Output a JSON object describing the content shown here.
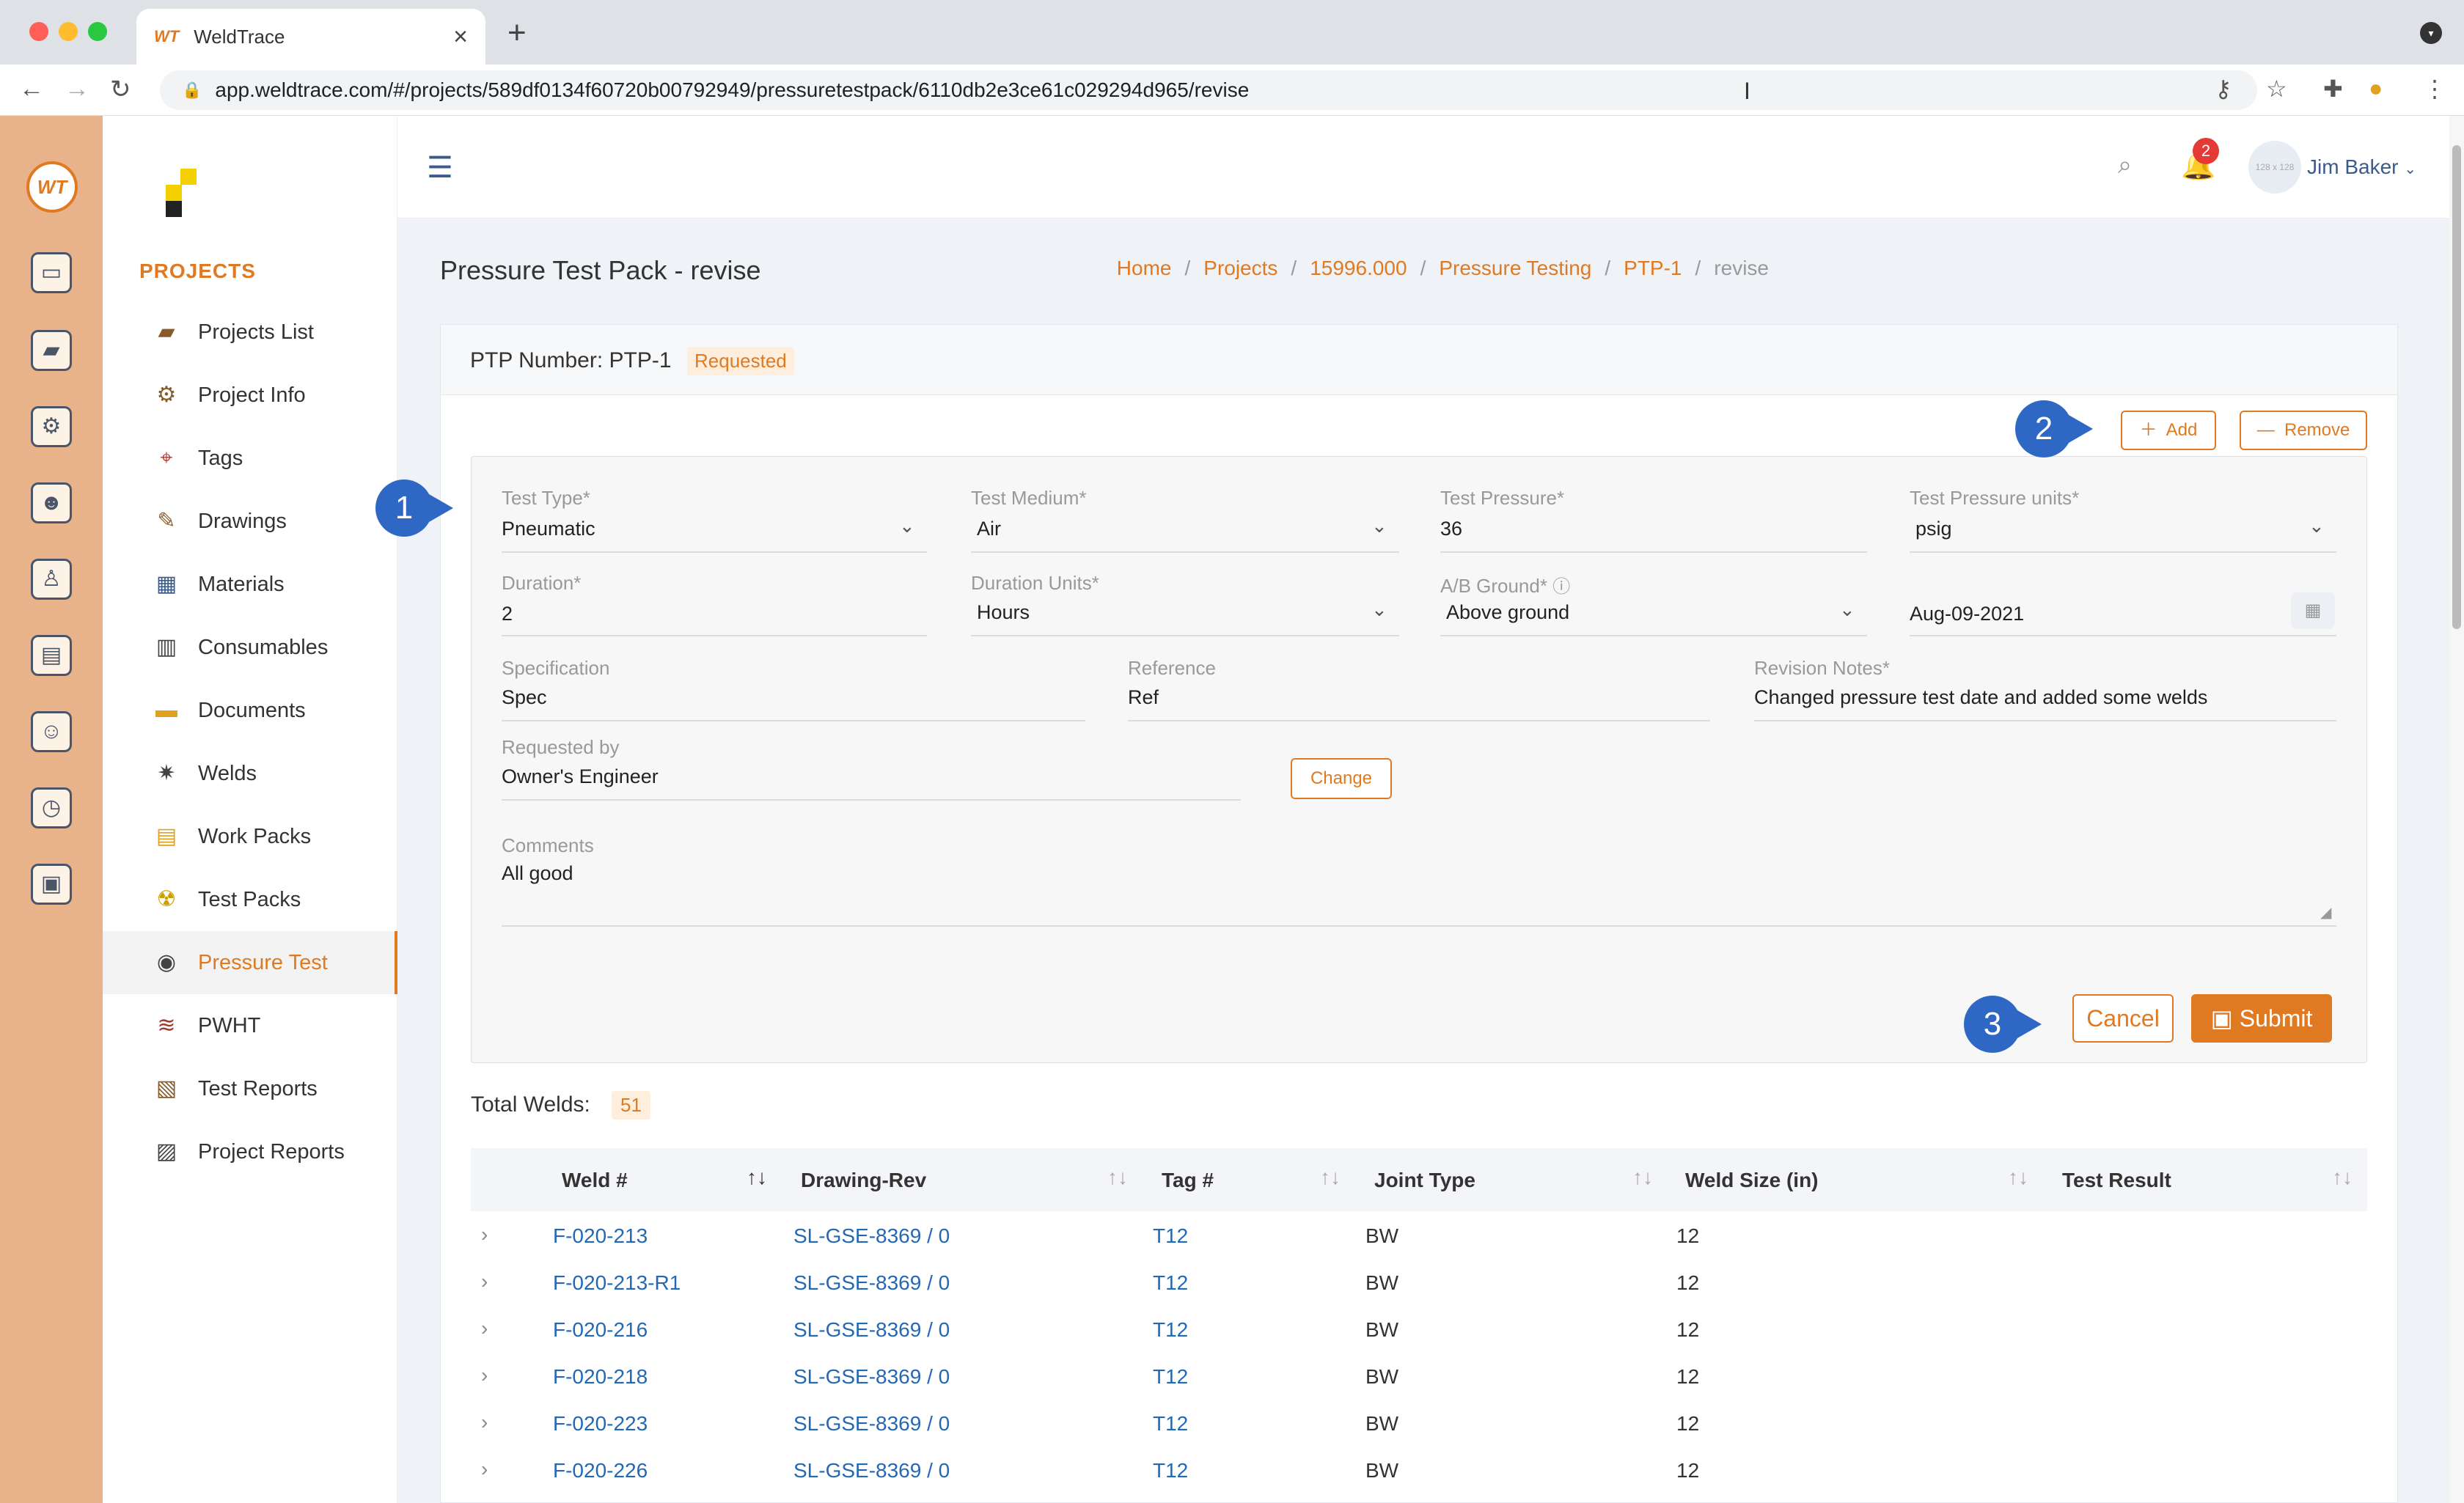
{
  "browser": {
    "tab_icon": "WT",
    "tab_title": "WeldTrace",
    "url": "app.weldtrace.com/#/projects/589df0134f60720b00792949/pressuretestpack/6110db2e3ce61c029294d965/revise"
  },
  "sidebar": {
    "section_title": "PROJECTS",
    "items": [
      {
        "label": "Projects List",
        "icon": "folder-camera-icon"
      },
      {
        "label": "Project Info",
        "icon": "gears-icon"
      },
      {
        "label": "Tags",
        "icon": "tag-icon"
      },
      {
        "label": "Drawings",
        "icon": "drawing-tools-icon"
      },
      {
        "label": "Materials",
        "icon": "materials-icon"
      },
      {
        "label": "Consumables",
        "icon": "consumables-icon"
      },
      {
        "label": "Documents",
        "icon": "documents-icon"
      },
      {
        "label": "Welds",
        "icon": "weld-spark-icon"
      },
      {
        "label": "Work Packs",
        "icon": "work-pack-icon"
      },
      {
        "label": "Test Packs",
        "icon": "radiation-icon"
      },
      {
        "label": "Pressure Test",
        "icon": "pressure-gauge-icon"
      },
      {
        "label": "PWHT",
        "icon": "heater-icon"
      },
      {
        "label": "Test Reports",
        "icon": "clipboard-icon"
      },
      {
        "label": "Project Reports",
        "icon": "report-chart-icon"
      }
    ],
    "active": "Pressure Test"
  },
  "header": {
    "notification_count": "2",
    "avatar_text": "128 x 128",
    "user_name": "Jim Baker"
  },
  "page": {
    "title": "Pressure Test Pack - revise",
    "breadcrumb": [
      "Home",
      "Projects",
      "15996.000",
      "Pressure Testing",
      "PTP-1",
      "revise"
    ]
  },
  "card": {
    "ptp_label": "PTP Number: PTP-1",
    "status": "Requested",
    "add_label": "Add",
    "remove_label": "Remove"
  },
  "form": {
    "test_type": {
      "label": "Test Type*",
      "value": "Pneumatic"
    },
    "test_medium": {
      "label": "Test Medium*",
      "value": "Air"
    },
    "test_pressure": {
      "label": "Test Pressure*",
      "value": "36"
    },
    "pressure_units": {
      "label": "Test Pressure units*",
      "value": "psig"
    },
    "duration": {
      "label": "Duration*",
      "value": "2"
    },
    "duration_units": {
      "label": "Duration Units*",
      "value": "Hours"
    },
    "ab_ground": {
      "label": "A/B Ground*",
      "value": "Above ground"
    },
    "date": {
      "value": "Aug-09-2021"
    },
    "specification": {
      "label": "Specification",
      "value": "Spec"
    },
    "reference": {
      "label": "Reference",
      "value": "Ref"
    },
    "revision_notes": {
      "label": "Revision Notes*",
      "value": "Changed pressure test date and added some welds"
    },
    "requested_by": {
      "label": "Requested by",
      "value": "Owner's Engineer"
    },
    "change_label": "Change",
    "comments": {
      "label": "Comments",
      "value": "All good"
    },
    "cancel_label": "Cancel",
    "submit_label": "Submit"
  },
  "markers": [
    "1",
    "2",
    "3"
  ],
  "welds": {
    "total_label": "Total Welds:",
    "total": "51",
    "columns": [
      "Weld #",
      "Drawing-Rev",
      "Tag #",
      "Joint Type",
      "Weld Size (in)",
      "Test Result"
    ],
    "rows": [
      {
        "weld": "F-020-213",
        "drawing": "SL-GSE-8369 / 0",
        "tag": "T12",
        "joint": "BW",
        "size": "12",
        "result": ""
      },
      {
        "weld": "F-020-213-R1",
        "drawing": "SL-GSE-8369 / 0",
        "tag": "T12",
        "joint": "BW",
        "size": "12",
        "result": ""
      },
      {
        "weld": "F-020-216",
        "drawing": "SL-GSE-8369 / 0",
        "tag": "T12",
        "joint": "BW",
        "size": "12",
        "result": ""
      },
      {
        "weld": "F-020-218",
        "drawing": "SL-GSE-8369 / 0",
        "tag": "T12",
        "joint": "BW",
        "size": "12",
        "result": ""
      },
      {
        "weld": "F-020-223",
        "drawing": "SL-GSE-8369 / 0",
        "tag": "T12",
        "joint": "BW",
        "size": "12",
        "result": ""
      },
      {
        "weld": "F-020-226",
        "drawing": "SL-GSE-8369 / 0",
        "tag": "T12",
        "joint": "BW",
        "size": "12",
        "result": ""
      }
    ]
  },
  "colors": {
    "accent": "#e07a22",
    "link": "#2468b4",
    "marker": "#2f68c4",
    "app_bar": "#e8b38a"
  }
}
